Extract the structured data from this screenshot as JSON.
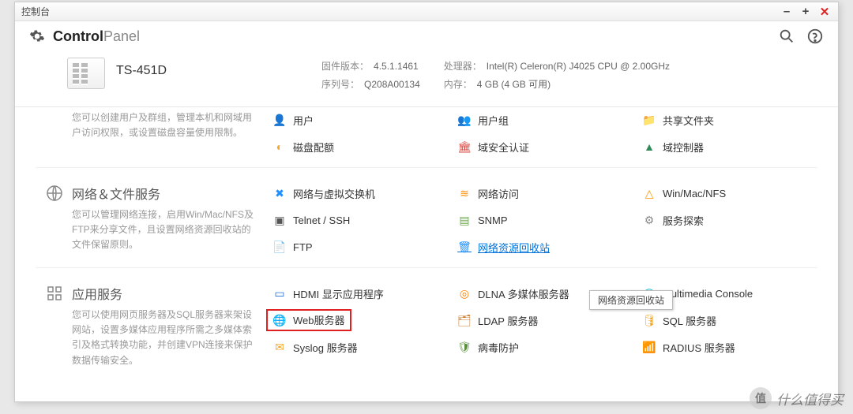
{
  "window_title": "控制台",
  "app_title": {
    "bold": "Control",
    "light": "Panel"
  },
  "model": "TS-451D",
  "sysinfo": {
    "fw_label": "固件版本：",
    "fw_value": "4.5.1.1461",
    "sn_label": "序列号：",
    "sn_value": "Q208A00134",
    "cpu_label": "处理器：",
    "cpu_value": "Intel(R) Celeron(R) J4025 CPU @ 2.00GHz",
    "mem_label": "内存：",
    "mem_value": "4 GB (4 GB 可用)"
  },
  "sections": [
    {
      "title": "",
      "desc": "您可以创建用户及群组，管理本机和网域用户访问权限，或设置磁盘容量使用限制。",
      "items": [
        {
          "label": "用户",
          "icon": "👤",
          "color": "#3a7bd5"
        },
        {
          "label": "用户组",
          "icon": "👥",
          "color": "#3a7bd5"
        },
        {
          "label": "共享文件夹",
          "icon": "📁",
          "color": "#f5a623"
        },
        {
          "label": "磁盘配额",
          "icon": "◐",
          "color": "#f5a623"
        },
        {
          "label": "域安全认证",
          "icon": "🏛",
          "color": "#d8453c"
        },
        {
          "label": "域控制器",
          "icon": "▲",
          "color": "#2e8b57"
        }
      ]
    },
    {
      "title": "网络＆文件服务",
      "icon": "globe",
      "desc": "您可以管理网络连接，启用Win/Mac/NFS及FTP来分享文件，且设置网络资源回收站的文件保留原则。",
      "items": [
        {
          "label": "网络与虚拟交换机",
          "icon": "✖",
          "color": "#1e90ff"
        },
        {
          "label": "网络访问",
          "icon": "≋",
          "color": "#ff8c00"
        },
        {
          "label": "Win/Mac/NFS",
          "icon": "△",
          "color": "#ff9500"
        },
        {
          "label": "Telnet / SSH",
          "icon": "▣",
          "color": "#555"
        },
        {
          "label": "SNMP",
          "icon": "▤",
          "color": "#6aa84f"
        },
        {
          "label": "服务探索",
          "icon": "⚙",
          "color": "#888"
        },
        {
          "label": "FTP",
          "icon": "📄",
          "color": "#f5a623"
        },
        {
          "label": "网络资源回收站",
          "icon": "🗑",
          "color": "#1e90ff",
          "link": true
        },
        {
          "label": "",
          "icon": "",
          "empty": true
        }
      ]
    },
    {
      "title": "应用服务",
      "icon": "grid",
      "desc": "您可以使用网页服务器及SQL服务器来架设网站，设置多媒体应用程序所需之多媒体索引及格式转换功能，并创建VPN连接来保护数据传输安全。",
      "items": [
        {
          "label": "HDMI 显示应用程序",
          "icon": "▭",
          "color": "#1e6fd8"
        },
        {
          "label": "DLNA 多媒体服务器",
          "icon": "◎",
          "color": "#ff7f00"
        },
        {
          "label": "Multimedia Console",
          "icon": "◯",
          "color": "#00bcd4"
        },
        {
          "label": "Web服务器",
          "icon": "🌐",
          "color": "#1e90ff",
          "highlight": true
        },
        {
          "label": "LDAP 服务器",
          "icon": "🗂",
          "color": "#c97b2e"
        },
        {
          "label": "SQL 服务器",
          "icon": "🛢",
          "color": "#f5a623"
        },
        {
          "label": "Syslog 服务器",
          "icon": "✉",
          "color": "#f5a623"
        },
        {
          "label": "病毒防护",
          "icon": "🛡",
          "color": "#5a8f3d"
        },
        {
          "label": "RADIUS 服务器",
          "icon": "📶",
          "color": "#6aa84f"
        }
      ]
    }
  ],
  "tooltip": "网络资源回收站",
  "watermark": "什么值得买"
}
